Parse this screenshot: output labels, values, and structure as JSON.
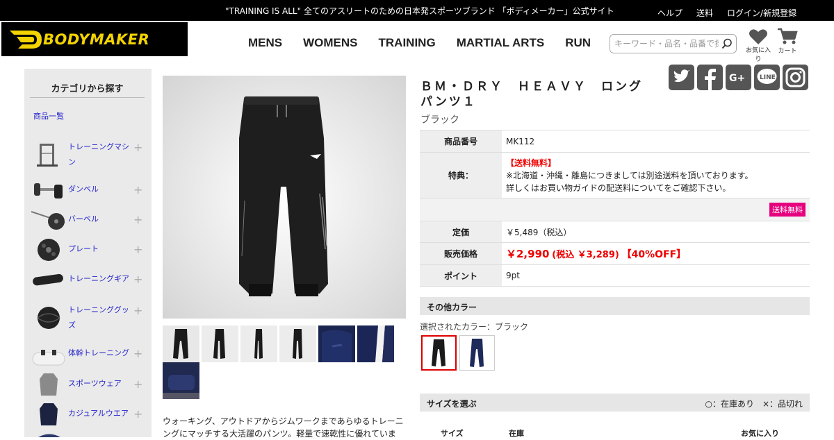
{
  "topbar": {
    "tagline": "\"TRAINING IS ALL\" 全てのアスリートのための日本発スポーツブランド 「ボディメーカー」公式サイト",
    "links": [
      "ヘルプ",
      "送料",
      "ログイン/新規登録"
    ]
  },
  "header": {
    "logo_text": "BODYMAKER",
    "nav": [
      "MENS",
      "WOMENS",
      "TRAINING",
      "MARTIAL ARTS",
      "RUN"
    ],
    "search_placeholder": "キーワード・品名・品番で探す",
    "favorites_label": "お気に入り",
    "cart_label": "カート"
  },
  "sidebar": {
    "title": "カテゴリから探す",
    "all_label": "商品一覧",
    "items": [
      {
        "label": "トレーニングマシン"
      },
      {
        "label": "ダンベル"
      },
      {
        "label": "バーベル"
      },
      {
        "label": "プレート"
      },
      {
        "label": "トレーニングギア"
      },
      {
        "label": "トレーニンググッズ"
      },
      {
        "label": "体幹トレーニング"
      },
      {
        "label": "スポーツウェア"
      },
      {
        "label": "カジュアルウエア"
      }
    ]
  },
  "product": {
    "title": "ＢＭ・ＤＲＹ　ＨＥＡＶＹ　ロングパンツ１",
    "color_name": "ブラック",
    "specs": {
      "item_no_label": "商品番号",
      "item_no": "MK112",
      "perk_label": "特典：",
      "perk_free_shipping": "【送料無料】",
      "perk_note_1": "※北海道・沖縄・離島につきましては別途送料を頂いております。",
      "perk_note_2": "詳しくはお買い物ガイドの配送料についてをご確認下さい。",
      "badge": "送料無料",
      "list_price_label": "定価",
      "list_price": "￥5,489（税込）",
      "sale_price_label": "販売価格",
      "sale_price": "￥2,990",
      "sale_price_tax": "(税込 ￥3,289)",
      "discount": "【40%OFF】",
      "points_label": "ポイント",
      "points": "9pt"
    },
    "description": "ウォーキング、アウトドアからジムワークまであらゆるトレーニングにマッチする大活躍のパンツ。軽量で速乾性に優れていま",
    "other_colors_title": "その他カラー",
    "selected_color_text": "選択されたカラー：ブラック",
    "size_section_title": "サイズを選ぶ",
    "size_legend": "○：在庫あり　×：品切れ",
    "size_table_headers": [
      "サイズ",
      "在庫",
      "お気に入り"
    ]
  },
  "social": [
    "twitter-icon",
    "facebook-icon",
    "google-plus-icon",
    "line-icon",
    "instagram-icon"
  ],
  "colors": {
    "accent_red": "#e00000",
    "badge_pink": "#e6007e",
    "logo_yellow": "#f4d400"
  }
}
